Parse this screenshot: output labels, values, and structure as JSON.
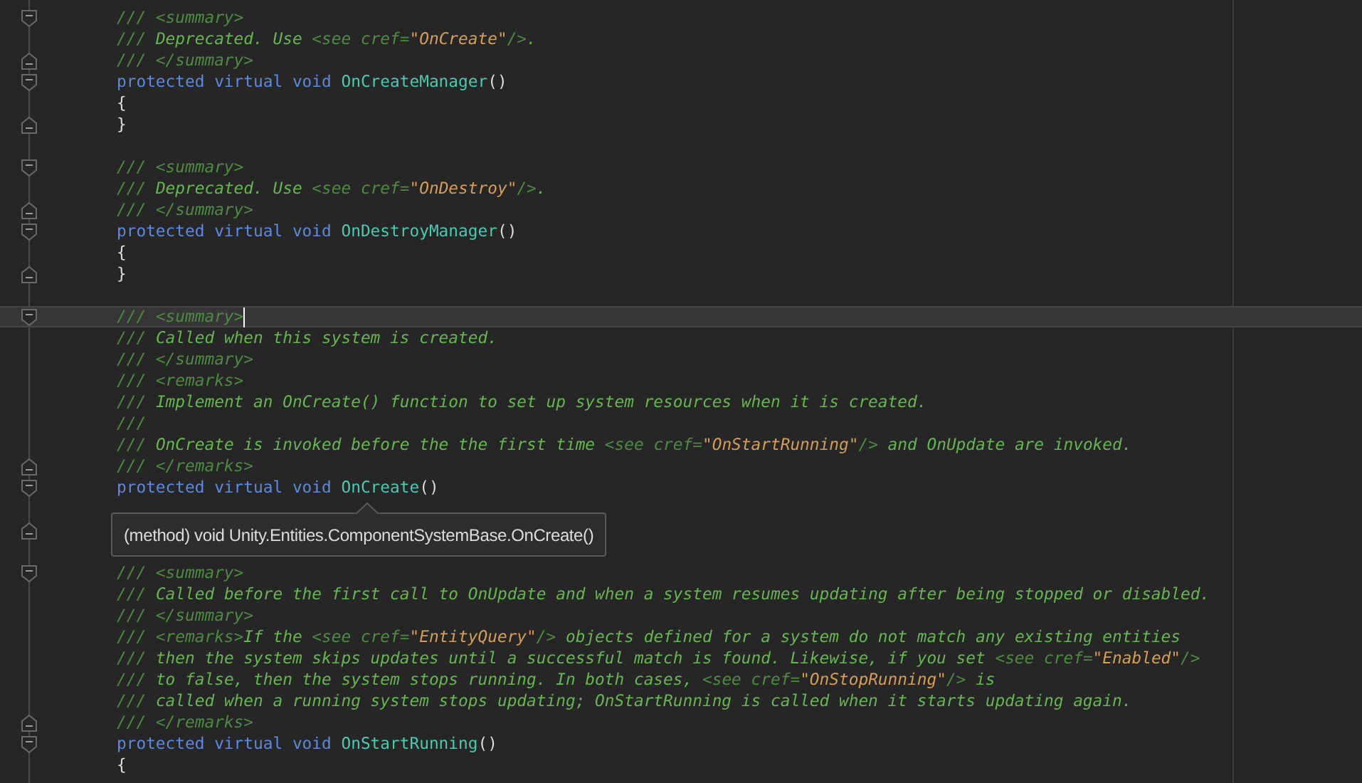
{
  "editor": {
    "lines": [
      {
        "fold_start": true,
        "fold_end": false,
        "current": false,
        "tokens": [
          {
            "kind": "doc-tag",
            "text": "/// <summary>"
          }
        ]
      },
      {
        "fold_start": false,
        "fold_end": false,
        "current": false,
        "tokens": [
          {
            "kind": "doc-tag",
            "text": "/// "
          },
          {
            "kind": "doc-text",
            "text": "Deprecated. Use "
          },
          {
            "kind": "doc-tag",
            "text": "<see cref="
          },
          {
            "kind": "string",
            "text": "\"OnCreate\""
          },
          {
            "kind": "doc-tag",
            "text": "/>"
          },
          {
            "kind": "doc-text",
            "text": "."
          }
        ]
      },
      {
        "fold_start": false,
        "fold_end": true,
        "current": false,
        "tokens": [
          {
            "kind": "doc-tag",
            "text": "/// </summary>"
          }
        ]
      },
      {
        "fold_start": true,
        "fold_end": false,
        "current": false,
        "tokens": [
          {
            "kind": "keyword",
            "text": "protected virtual void "
          },
          {
            "kind": "method",
            "text": "OnCreateManager"
          },
          {
            "kind": "punct",
            "text": "()"
          }
        ]
      },
      {
        "fold_start": false,
        "fold_end": false,
        "current": false,
        "tokens": [
          {
            "kind": "punct",
            "text": "{"
          }
        ]
      },
      {
        "fold_start": false,
        "fold_end": true,
        "current": false,
        "tokens": [
          {
            "kind": "punct",
            "text": "}"
          }
        ]
      },
      {
        "fold_start": false,
        "fold_end": false,
        "current": false
      },
      {
        "fold_start": true,
        "fold_end": false,
        "current": false,
        "tokens": [
          {
            "kind": "doc-tag",
            "text": "/// <summary>"
          }
        ]
      },
      {
        "fold_start": false,
        "fold_end": false,
        "current": false,
        "tokens": [
          {
            "kind": "doc-tag",
            "text": "/// "
          },
          {
            "kind": "doc-text",
            "text": "Deprecated. Use "
          },
          {
            "kind": "doc-tag",
            "text": "<see cref="
          },
          {
            "kind": "string",
            "text": "\"OnDestroy\""
          },
          {
            "kind": "doc-tag",
            "text": "/>"
          },
          {
            "kind": "doc-text",
            "text": "."
          }
        ]
      },
      {
        "fold_start": false,
        "fold_end": true,
        "current": false,
        "tokens": [
          {
            "kind": "doc-tag",
            "text": "/// </summary>"
          }
        ]
      },
      {
        "fold_start": true,
        "fold_end": false,
        "current": false,
        "tokens": [
          {
            "kind": "keyword",
            "text": "protected virtual void "
          },
          {
            "kind": "method",
            "text": "OnDestroyManager"
          },
          {
            "kind": "punct",
            "text": "()"
          }
        ]
      },
      {
        "fold_start": false,
        "fold_end": false,
        "current": false,
        "tokens": [
          {
            "kind": "punct",
            "text": "{"
          }
        ]
      },
      {
        "fold_start": false,
        "fold_end": true,
        "current": false,
        "tokens": [
          {
            "kind": "punct",
            "text": "}"
          }
        ]
      },
      {
        "fold_start": false,
        "fold_end": false,
        "current": false
      },
      {
        "fold_start": true,
        "fold_end": false,
        "current": true,
        "tokens": [
          {
            "kind": "doc-tag",
            "text": "/// <summary>"
          }
        ]
      },
      {
        "fold_start": false,
        "fold_end": false,
        "current": false,
        "tokens": [
          {
            "kind": "doc-tag",
            "text": "/// "
          },
          {
            "kind": "doc-text",
            "text": "Called when this system is created."
          }
        ]
      },
      {
        "fold_start": false,
        "fold_end": false,
        "current": false,
        "tokens": [
          {
            "kind": "doc-tag",
            "text": "/// </summary>"
          }
        ]
      },
      {
        "fold_start": false,
        "fold_end": false,
        "current": false,
        "tokens": [
          {
            "kind": "doc-tag",
            "text": "/// <remarks>"
          }
        ]
      },
      {
        "fold_start": false,
        "fold_end": false,
        "current": false,
        "tokens": [
          {
            "kind": "doc-tag",
            "text": "/// "
          },
          {
            "kind": "doc-text",
            "text": "Implement an OnCreate() function to set up system resources when it is created."
          }
        ]
      },
      {
        "fold_start": false,
        "fold_end": false,
        "current": false,
        "tokens": [
          {
            "kind": "doc-tag",
            "text": "///"
          }
        ]
      },
      {
        "fold_start": false,
        "fold_end": false,
        "current": false,
        "tokens": [
          {
            "kind": "doc-tag",
            "text": "/// "
          },
          {
            "kind": "doc-text",
            "text": "OnCreate is invoked before the the first time "
          },
          {
            "kind": "doc-tag",
            "text": "<see cref="
          },
          {
            "kind": "string",
            "text": "\"OnStartRunning\""
          },
          {
            "kind": "doc-tag",
            "text": "/>"
          },
          {
            "kind": "doc-text",
            "text": " and OnUpdate are invoked."
          }
        ]
      },
      {
        "fold_start": false,
        "fold_end": true,
        "current": false,
        "tokens": [
          {
            "kind": "doc-tag",
            "text": "/// </remarks>"
          }
        ]
      },
      {
        "fold_start": true,
        "fold_end": false,
        "current": false,
        "tokens": [
          {
            "kind": "keyword",
            "text": "protected virtual void "
          },
          {
            "kind": "method",
            "text": "OnCreate"
          },
          {
            "kind": "punct",
            "text": "()"
          }
        ]
      },
      {
        "fold_start": false,
        "fold_end": false,
        "current": false
      },
      {
        "fold_start": false,
        "fold_end": true,
        "current": false
      },
      {
        "fold_start": false,
        "fold_end": false,
        "current": false
      },
      {
        "fold_start": true,
        "fold_end": false,
        "current": false,
        "tokens": [
          {
            "kind": "doc-tag",
            "text": "/// <summary>"
          }
        ]
      },
      {
        "fold_start": false,
        "fold_end": false,
        "current": false,
        "tokens": [
          {
            "kind": "doc-tag",
            "text": "/// "
          },
          {
            "kind": "doc-text",
            "text": "Called before the first call to OnUpdate and when a system resumes updating after being stopped or disabled."
          }
        ]
      },
      {
        "fold_start": false,
        "fold_end": false,
        "current": false,
        "tokens": [
          {
            "kind": "doc-tag",
            "text": "/// </summary>"
          }
        ]
      },
      {
        "fold_start": false,
        "fold_end": false,
        "current": false,
        "tokens": [
          {
            "kind": "doc-tag",
            "text": "/// <remarks>"
          },
          {
            "kind": "doc-text",
            "text": "If the "
          },
          {
            "kind": "doc-tag",
            "text": "<see cref="
          },
          {
            "kind": "string",
            "text": "\"EntityQuery\""
          },
          {
            "kind": "doc-tag",
            "text": "/>"
          },
          {
            "kind": "doc-text",
            "text": " objects defined for a system do not match any existing entities"
          }
        ]
      },
      {
        "fold_start": false,
        "fold_end": false,
        "current": false,
        "tokens": [
          {
            "kind": "doc-tag",
            "text": "/// "
          },
          {
            "kind": "doc-text",
            "text": "then the system skips updates until a successful match is found. Likewise, if you set "
          },
          {
            "kind": "doc-tag",
            "text": "<see cref="
          },
          {
            "kind": "string",
            "text": "\"Enabled\""
          },
          {
            "kind": "doc-tag",
            "text": "/>"
          }
        ]
      },
      {
        "fold_start": false,
        "fold_end": false,
        "current": false,
        "tokens": [
          {
            "kind": "doc-tag",
            "text": "/// "
          },
          {
            "kind": "doc-text",
            "text": "to false, then the system stops running. In both cases, "
          },
          {
            "kind": "doc-tag",
            "text": "<see cref="
          },
          {
            "kind": "string",
            "text": "\"OnStopRunning\""
          },
          {
            "kind": "doc-tag",
            "text": "/>"
          },
          {
            "kind": "doc-text",
            "text": " is"
          }
        ]
      },
      {
        "fold_start": false,
        "fold_end": false,
        "current": false,
        "tokens": [
          {
            "kind": "doc-tag",
            "text": "/// "
          },
          {
            "kind": "doc-text",
            "text": "called when a running system stops updating; OnStartRunning is called when it starts updating again."
          }
        ]
      },
      {
        "fold_start": false,
        "fold_end": true,
        "current": false,
        "tokens": [
          {
            "kind": "doc-tag",
            "text": "/// </remarks>"
          }
        ]
      },
      {
        "fold_start": true,
        "fold_end": false,
        "current": false,
        "tokens": [
          {
            "kind": "keyword",
            "text": "protected virtual void "
          },
          {
            "kind": "method",
            "text": "OnStartRunning"
          },
          {
            "kind": "punct",
            "text": "()"
          }
        ]
      },
      {
        "fold_start": false,
        "fold_end": false,
        "current": false,
        "tokens": [
          {
            "kind": "punct",
            "text": "{"
          }
        ]
      }
    ],
    "tooltip": {
      "text": "(method) void Unity.Entities.ComponentSystemBase.OnCreate()"
    }
  }
}
